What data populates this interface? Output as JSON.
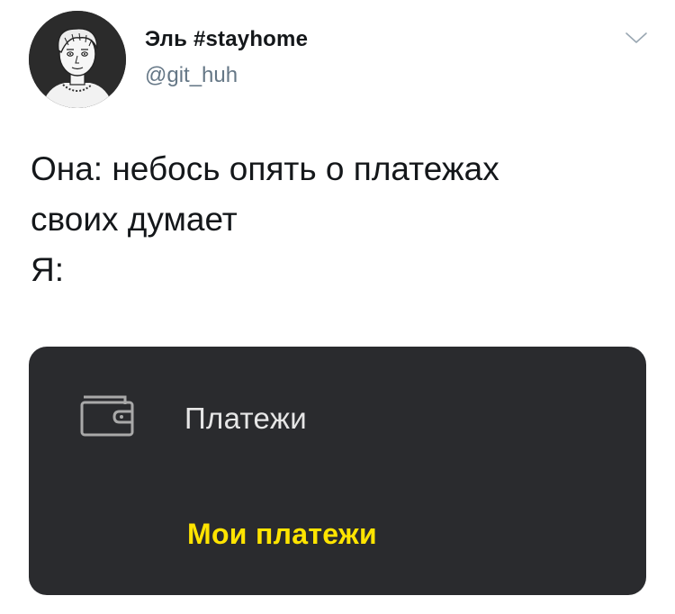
{
  "tweet": {
    "author": {
      "display_name": "Эль #stayhome",
      "handle": "@git_huh",
      "avatar_icon": "avatar-illustration"
    },
    "menu_icon": "chevron-down-icon",
    "text_lines": [
      "Она: небось опять о платежах",
      "своих думает",
      "Я:"
    ],
    "media": {
      "background_color": "#2a2b2e",
      "menu_item": {
        "icon": "wallet-icon",
        "label": "Платежи"
      },
      "submenu_item": {
        "label": "Мои платежи",
        "color": "#ffe400"
      }
    }
  }
}
